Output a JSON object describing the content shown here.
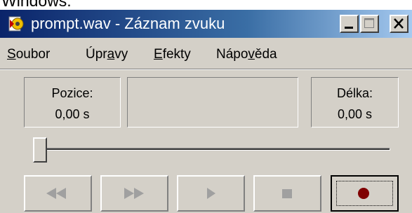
{
  "top_caption": "Windows:",
  "window": {
    "title": "prompt.wav - Záznam zvuku",
    "title_icon": "sound-recorder-icon",
    "controls": [
      "minimize-icon",
      "maximize-icon",
      "close-icon"
    ]
  },
  "menu": {
    "items": [
      {
        "label": "Soubor",
        "accel_before": "",
        "accel": "S",
        "accel_after": "oubor"
      },
      {
        "label": "Úpravy",
        "accel_before": "Úpr",
        "accel": "a",
        "accel_after": "vy"
      },
      {
        "label": "Efekty",
        "accel_before": "",
        "accel": "E",
        "accel_after": "fekty"
      },
      {
        "label": "Nápověda",
        "accel_before": "Nápo",
        "accel": "v",
        "accel_after": "ěda"
      }
    ]
  },
  "position": {
    "label": "Pozice:",
    "value": "0,00 s"
  },
  "length": {
    "label": "Délka:",
    "value": "0,00 s"
  },
  "slider": {
    "position_fraction": 0
  },
  "transport": {
    "buttons": [
      {
        "icon": "seek-start-icon",
        "enabled": false
      },
      {
        "icon": "seek-end-icon",
        "enabled": false
      },
      {
        "icon": "play-icon",
        "enabled": false
      },
      {
        "icon": "stop-icon",
        "enabled": false
      },
      {
        "icon": "record-icon",
        "enabled": true,
        "color": "#800000"
      }
    ]
  },
  "colors": {
    "window_bg": "#d4d0c8",
    "title_start": "#0a246a",
    "title_end": "#a6caf0",
    "disabled_glyph": "#a0a0a0",
    "record": "#800000"
  }
}
